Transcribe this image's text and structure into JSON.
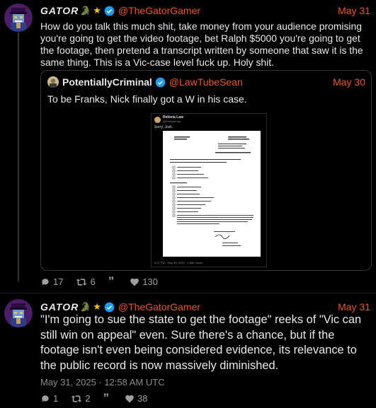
{
  "tweet1": {
    "name": "GATOR",
    "handle": "@TheGatorGamer",
    "date": "May 31",
    "text": "How do you talk this much shit, take money from your audience promising you're going to get the video footage, bet Ralph $5000 you're going to get the footage, then pretend a transcript written by someone that saw it is the same thing. This is a Vic-case level fuck up. Holy shit.",
    "quote": {
      "name": "PotentiallyCriminal",
      "handle": "@LawTubeSean",
      "date": "May 30",
      "text": "To be Franks, Nick finally got a W in his case.",
      "media": {
        "author": "Rekieta Law",
        "author_handle": "@RekietaLaw",
        "caption": "Sorry, Josh.",
        "doc_header_left": "State of Minnesota\nCounty of ______",
        "doc_header_right": "District Court\nEighth Judicial District",
        "doc_title": "Notice of Judicial Determination",
        "footer": "5:21 PM · May 30, 2025 · 2,886 Views"
      }
    },
    "stats": {
      "replies": "17",
      "retweets": "6",
      "quotes": "",
      "likes": "130"
    }
  },
  "tweet2": {
    "name": "GATOR",
    "handle": "@TheGatorGamer",
    "date": "May 31",
    "text": "\"I'm going to sue the state to get the footage\" reeks of \"Vic can still win on appeal\" even. Sure there's a chance, but if the footage isn't even being considered evidence, its relevance to the public record is now massively diminished.",
    "timestamp": "May 31, 2025 · 12:58 AM UTC",
    "stats": {
      "replies": "1",
      "retweets": "2",
      "quotes": "",
      "likes": "38"
    }
  },
  "colors": {
    "accent": "#f4511e",
    "verified": "#1d9bf0",
    "background": "#000000",
    "text": "#e7e9ea",
    "muted": "#a0a0a0"
  },
  "icons": [
    "gator-avatar",
    "croc-emoji",
    "star-emoji",
    "verified-badge",
    "reply-icon",
    "retweet-icon",
    "quote-icon",
    "like-icon"
  ]
}
